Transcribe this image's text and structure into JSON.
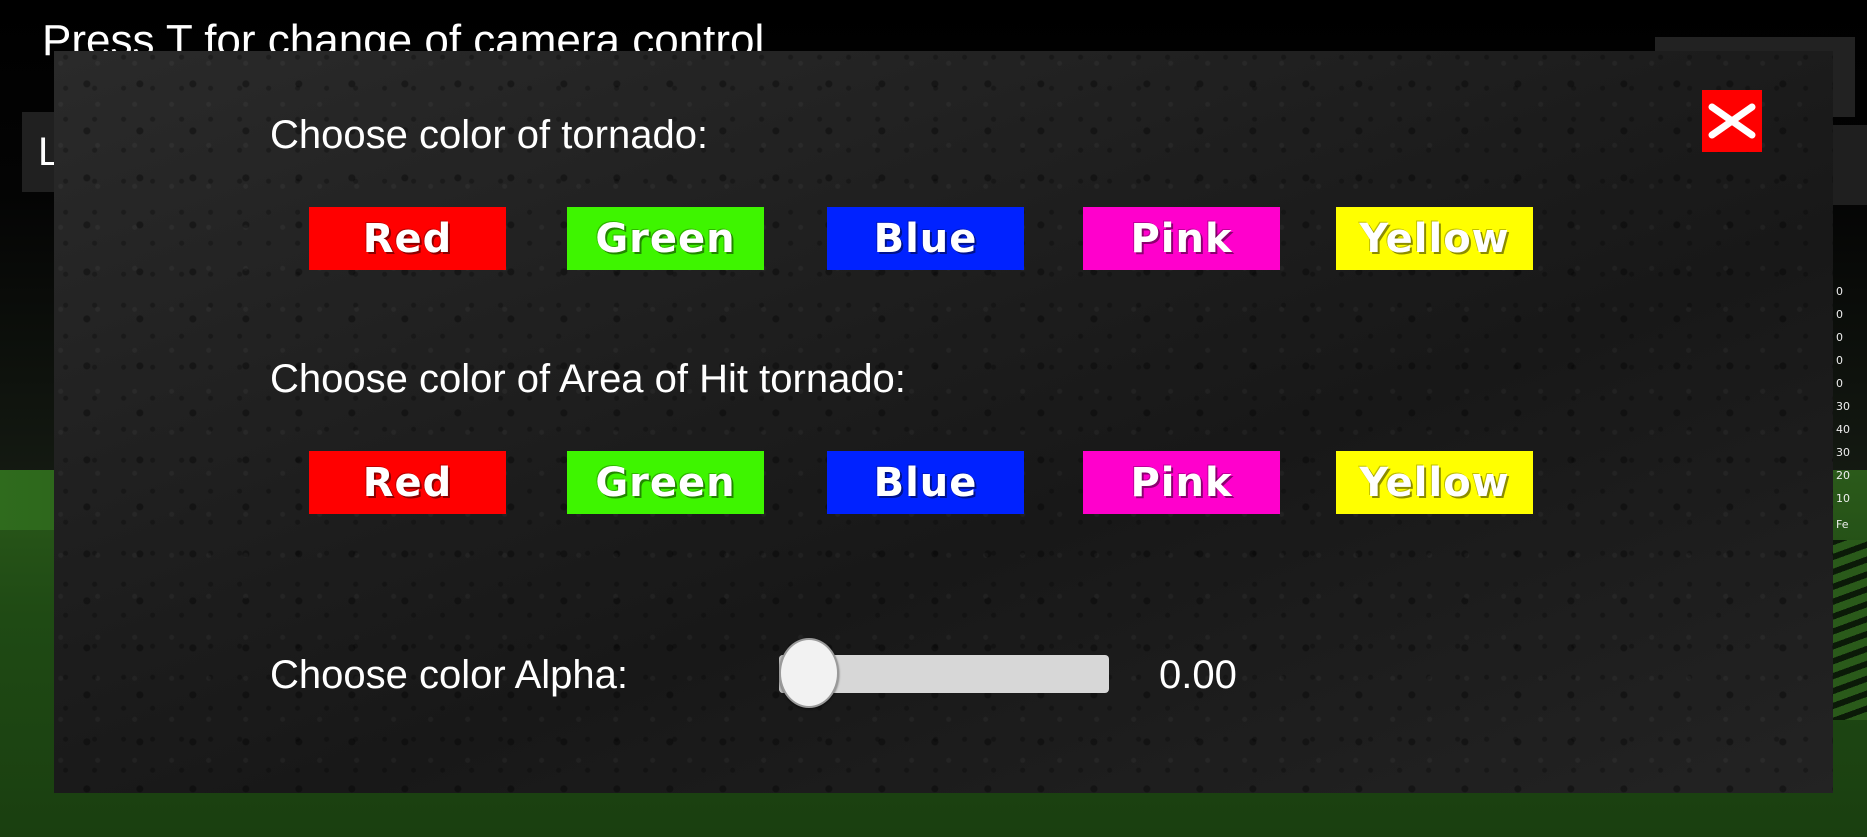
{
  "hud": {
    "camera_hint": "Press T for change of camera control",
    "left_panel_text": "L",
    "scale_ticks": [
      "0",
      "0",
      "0",
      "0",
      "0",
      "30",
      "40",
      "30",
      "20",
      "10",
      "Fe"
    ]
  },
  "dialog": {
    "close_icon": "close-icon",
    "tornado_color": {
      "label": "Choose color of tornado:",
      "options": [
        {
          "label": "Red",
          "color": "#ff0000"
        },
        {
          "label": "Green",
          "color": "#3ef500"
        },
        {
          "label": "Blue",
          "color": "#0022ff"
        },
        {
          "label": "Pink",
          "color": "#ff00cc"
        },
        {
          "label": "Yellow",
          "color": "#ffff00"
        }
      ]
    },
    "hit_area_color": {
      "label": "Choose color of Area of Hit tornado:",
      "options": [
        {
          "label": "Red",
          "color": "#ff0000"
        },
        {
          "label": "Green",
          "color": "#3ef500"
        },
        {
          "label": "Blue",
          "color": "#0022ff"
        },
        {
          "label": "Pink",
          "color": "#ff00cc"
        },
        {
          "label": "Yellow",
          "color": "#ffff00"
        }
      ]
    },
    "alpha": {
      "label": "Choose color Alpha:",
      "value": 0.0,
      "value_text": "0.00"
    }
  }
}
